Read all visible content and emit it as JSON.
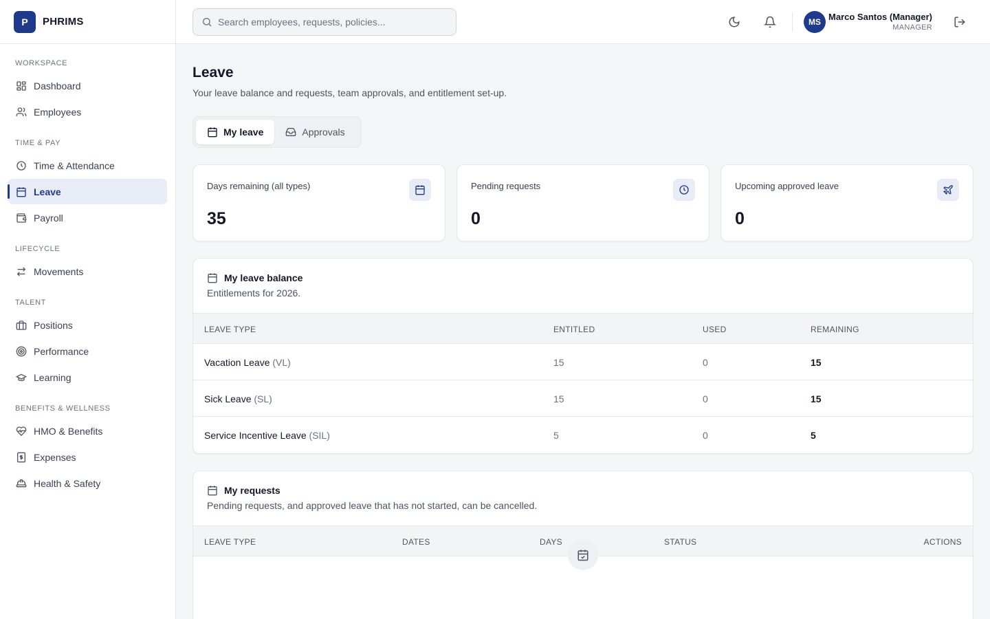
{
  "app": {
    "logo_letter": "P",
    "name": "PHRIMS"
  },
  "sidebar": {
    "sections": [
      {
        "label": "WORKSPACE",
        "items": [
          {
            "label": "Dashboard",
            "icon": "dashboard-icon"
          },
          {
            "label": "Employees",
            "icon": "users-icon"
          }
        ]
      },
      {
        "label": "TIME & PAY",
        "items": [
          {
            "label": "Time & Attendance",
            "icon": "clock-icon"
          },
          {
            "label": "Leave",
            "icon": "calendar-icon",
            "active": true
          },
          {
            "label": "Payroll",
            "icon": "wallet-icon"
          }
        ]
      },
      {
        "label": "LIFECYCLE",
        "items": [
          {
            "label": "Movements",
            "icon": "arrows-swap-icon"
          }
        ]
      },
      {
        "label": "TALENT",
        "items": [
          {
            "label": "Positions",
            "icon": "briefcase-icon"
          },
          {
            "label": "Performance",
            "icon": "target-icon"
          },
          {
            "label": "Learning",
            "icon": "graduation-cap-icon"
          }
        ]
      },
      {
        "label": "BENEFITS & WELLNESS",
        "items": [
          {
            "label": "HMO & Benefits",
            "icon": "heart-pulse-icon"
          },
          {
            "label": "Expenses",
            "icon": "receipt-dollar-icon"
          },
          {
            "label": "Health & Safety",
            "icon": "hard-hat-icon"
          }
        ]
      }
    ]
  },
  "topbar": {
    "search_placeholder": "Search employees, requests, policies...",
    "user": {
      "initials": "MS",
      "name": "Marco Santos (Manager)",
      "role": "MANAGER"
    }
  },
  "page": {
    "title": "Leave",
    "subtitle": "Your leave balance and requests, team approvals, and entitlement set-up.",
    "tabs": [
      {
        "label": "My leave",
        "active": true
      },
      {
        "label": "Approvals"
      }
    ]
  },
  "stats": [
    {
      "label": "Days remaining (all types)",
      "value": "35",
      "icon": "calendar-icon"
    },
    {
      "label": "Pending requests",
      "value": "0",
      "icon": "clock-icon"
    },
    {
      "label": "Upcoming approved leave",
      "value": "0",
      "icon": "plane-icon"
    }
  ],
  "balance": {
    "title": "My leave balance",
    "subtitle": "Entitlements for 2026.",
    "columns": [
      "LEAVE TYPE",
      "ENTITLED",
      "USED",
      "REMAINING"
    ],
    "rows": [
      {
        "type": "Vacation Leave",
        "code": "(VL)",
        "entitled": "15",
        "used": "0",
        "remaining": "15"
      },
      {
        "type": "Sick Leave",
        "code": "(SL)",
        "entitled": "15",
        "used": "0",
        "remaining": "15"
      },
      {
        "type": "Service Incentive Leave",
        "code": "(SIL)",
        "entitled": "5",
        "used": "0",
        "remaining": "5"
      }
    ]
  },
  "requests": {
    "title": "My requests",
    "subtitle": "Pending requests, and approved leave that has not started, can be cancelled.",
    "columns": [
      "LEAVE TYPE",
      "DATES",
      "DAYS",
      "STATUS",
      "ACTIONS"
    ]
  },
  "colors": {
    "brand": "#1e3a8a",
    "active_bg": "#e8ecf6"
  }
}
